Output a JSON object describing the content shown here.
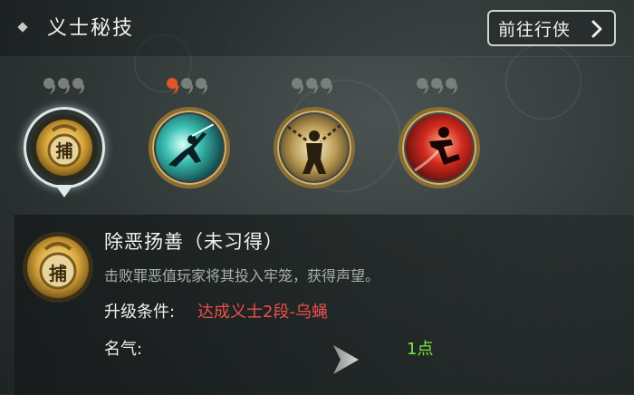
{
  "header": {
    "title": "义士秘技",
    "goto_button_label": "前往行侠"
  },
  "skills": [
    {
      "name": "除恶扬善",
      "icon": "capture-seal-icon",
      "level_dots": 3,
      "active_dots": 0,
      "selected": true
    },
    {
      "name": "",
      "icon": "sword-dash-icon",
      "level_dots": 3,
      "active_dots": 1,
      "selected": false
    },
    {
      "name": "",
      "icon": "chained-figure-icon",
      "level_dots": 3,
      "active_dots": 0,
      "selected": false
    },
    {
      "name": "",
      "icon": "flying-kick-icon",
      "level_dots": 3,
      "active_dots": 0,
      "selected": false
    }
  ],
  "detail": {
    "badge_char": "捕",
    "name": "除恶扬善（未习得）",
    "description": "击败罪恶值玩家将其投入牢笼，获得声望。",
    "condition_label": "升级条件:",
    "condition_value": "达成义士2段-乌蝇",
    "fame_label": "名气:",
    "fame_value": "1点"
  },
  "colors": {
    "condition": "#e8504a",
    "fame": "#7ee63a",
    "active_dot": "#e4542b"
  }
}
